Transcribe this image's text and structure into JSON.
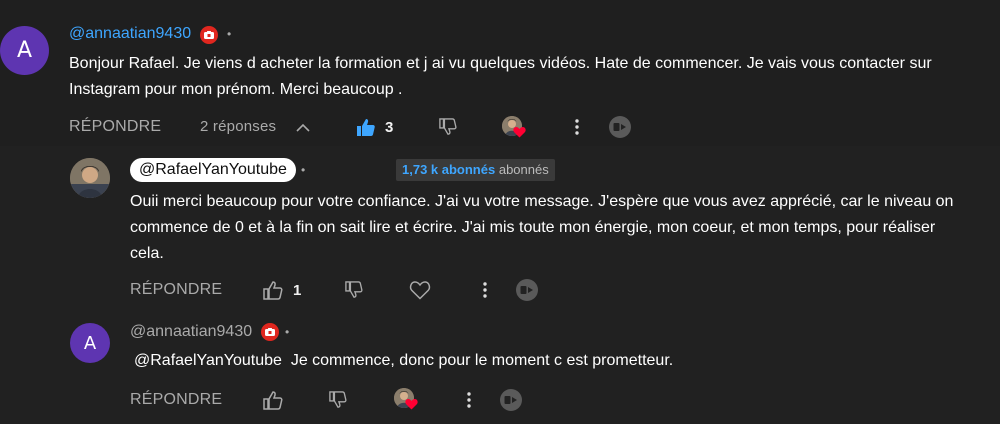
{
  "colors": {
    "accent": "#3ea6ff",
    "background": "#181818",
    "avatar": "#5e35b1",
    "badge_red": "#e0271f"
  },
  "comment": {
    "avatar_letter": "A",
    "author": "@annaatian9430",
    "badge_icon": "youtube-member-badge-icon",
    "separator": "•",
    "text_line1": "Bonjour Rafael. Je viens d acheter la formation et j ai vu quelques vidéos.  Hate de commencer. Je vais vous contacter sur",
    "text_line2": "Instagram pour mon prénom. Merci beaucoup .",
    "reply_label": "RÉPONDRE",
    "replies_toggle": "2 réponses",
    "like_count": "3"
  },
  "reply1": {
    "author": "@RafaelYanYoutube",
    "separator": "•",
    "subscribers_strong": "1,73 k abonnés",
    "subscribers_weak": "abonnés",
    "text_line1": "Ouii merci beaucoup pour votre confiance. J'ai vu votre message. J'espère que vous avez apprécié, car le niveau on",
    "text_line2": "commence de 0 et à la fin on sait lire et écrire. J'ai mis toute mon énergie, mon coeur, et mon temps, pour réaliser",
    "text_line3": "cela.",
    "reply_label": "RÉPONDRE",
    "like_count": "1"
  },
  "reply2": {
    "avatar_letter": "A",
    "author": "@annaatian9430",
    "separator": "•",
    "mention": "@RafaelYanYoutube",
    "text": "  Je commence, donc pour le moment c est prometteur.",
    "reply_label": "RÉPONDRE"
  }
}
